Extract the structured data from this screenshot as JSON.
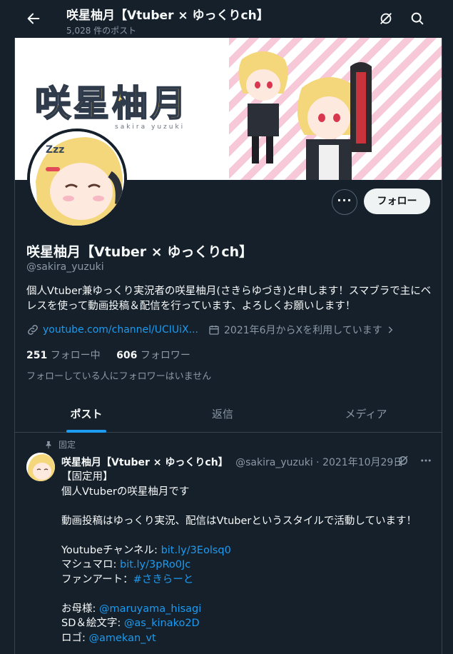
{
  "header": {
    "title": "咲星柚月【Vtuber × ゆっくりch】",
    "post_count": "5,028 件のポスト"
  },
  "banner": {
    "logo_text": "咲星柚月",
    "logo_sub": "sakira yuzuki"
  },
  "profile": {
    "more_label": "···",
    "follow_label": "フォロー",
    "name": "咲星柚月【Vtuber × ゆっくりch】",
    "handle": "@sakira_yuzuki",
    "bio": "個人Vtuber兼ゆっくり実況者の咲星柚月(さきらゆづき)と申します！スマブラで主にベレスを使って動画投稿＆配信を行っています、よろしくお願いします！",
    "link": "youtube.com/channel/UCIUiX...",
    "joined": "2021年6月からXを利用しています",
    "following_count": "251",
    "following_label": "フォロー中",
    "followers_count": "606",
    "followers_label": "フォロワー",
    "no_mutuals": "フォローしている人にフォロワーはいません"
  },
  "tabs": [
    {
      "label": "ポスト",
      "active": true
    },
    {
      "label": "返信",
      "active": false
    },
    {
      "label": "メディア",
      "active": false
    }
  ],
  "pinned_post": {
    "pinned_label": "固定",
    "author_name": "咲星柚月【Vtuber × ゆっくりch】",
    "author_handle": "@sakira_yuzuki",
    "separator": "·",
    "date": "2021年10月29日",
    "line1": "【固定用】",
    "line2": "個人Vtuberの咲星柚月です",
    "line3": "動画投稿はゆっくり実況、配信はVtuberというスタイルで活動しています！",
    "youtube_label": "Youtubeチャンネル: ",
    "youtube_link": "bit.ly/3Eolsq0",
    "marshmallow_label": "マシュマロ: ",
    "marshmallow_link": "bit.ly/3pRo0Jc",
    "fanart_label": "ファンアート：",
    "fanart_tag": "#さきらーと",
    "mother_label": "お母様: ",
    "mother_link": "@maruyama_hisagi",
    "sd_label": "SD＆絵文字: ",
    "sd_link": "@as_kinako2D",
    "logo_label": "ロゴ: ",
    "logo_link": "@amekan_vt"
  },
  "colors": {
    "background": "#15202b",
    "accent": "#1d9bf0",
    "muted_text": "#8b98a5",
    "follow_button": "#eff3f4"
  }
}
